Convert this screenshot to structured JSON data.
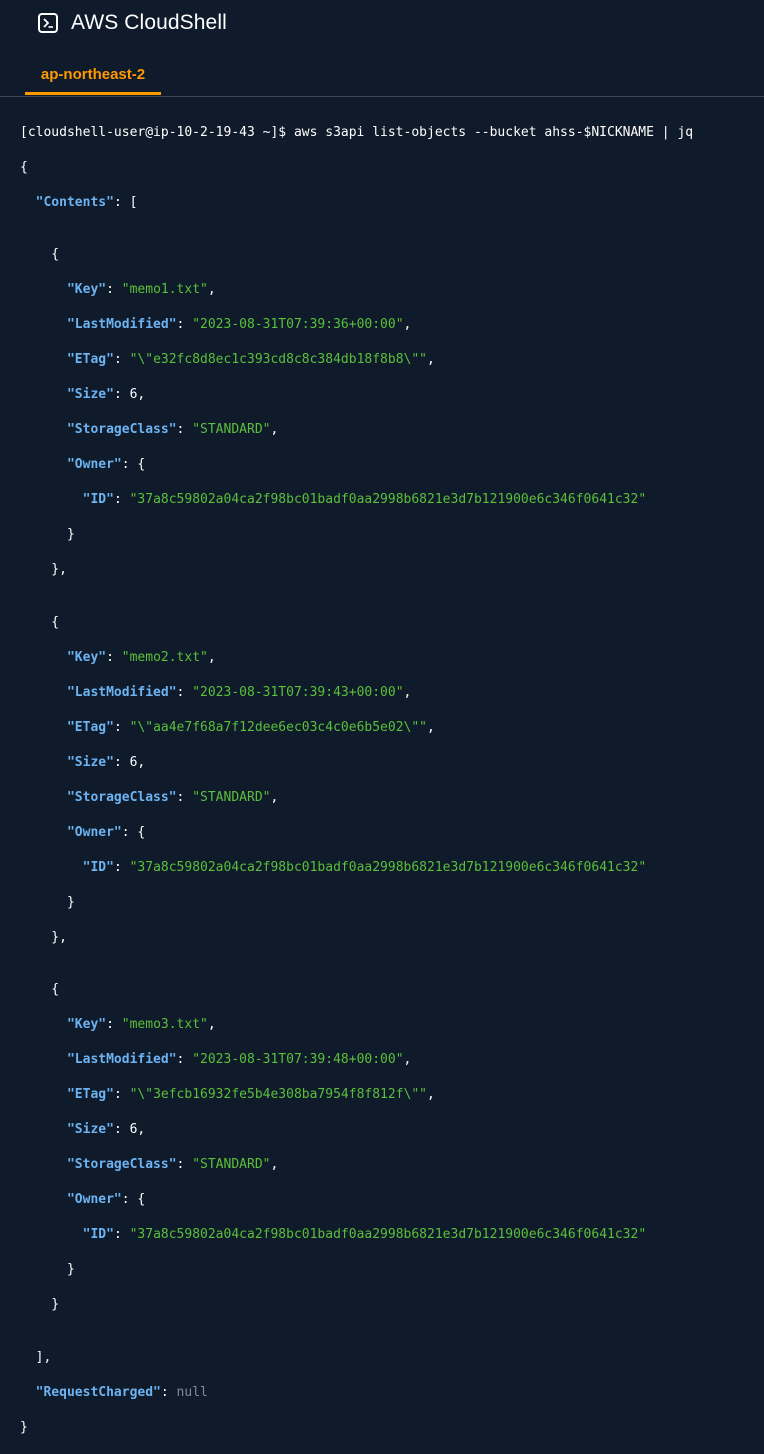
{
  "header": {
    "title": "AWS CloudShell",
    "tab": "ap-northeast-2"
  },
  "icons": {
    "app": "terminal-prompt-icon"
  },
  "colors": {
    "background": "#0f1b2a",
    "accent": "#ff9900",
    "json_key": "#6db3f2",
    "json_string": "#5bbf3a",
    "json_null": "#7d8a99"
  },
  "terminal": {
    "prompt": "[cloudshell-user@ip-10-2-19-43 ~]$ ",
    "command": "aws s3api list-objects --bucket ahss-$NICKNAME | jq",
    "contents_key": "\"Contents\"",
    "objects": [
      {
        "key": "\"memo1.txt\"",
        "last_modified": "\"2023-08-31T07:39:36+00:00\"",
        "etag": "\"\\\"e32fc8d8ec1c393cd8c8c384db18f8b8\\\"\"",
        "size": "6",
        "storage_class": "\"STANDARD\"",
        "owner_id": "\"37a8c59802a04ca2f98bc01badf0aa2998b6821e3d7b121900e6c346f0641c32\""
      },
      {
        "key": "\"memo2.txt\"",
        "last_modified": "\"2023-08-31T07:39:43+00:00\"",
        "etag": "\"\\\"aa4e7f68a7f12dee6ec03c4c0e6b5e02\\\"\"",
        "size": "6",
        "storage_class": "\"STANDARD\"",
        "owner_id": "\"37a8c59802a04ca2f98bc01badf0aa2998b6821e3d7b121900e6c346f0641c32\""
      },
      {
        "key": "\"memo3.txt\"",
        "last_modified": "\"2023-08-31T07:39:48+00:00\"",
        "etag": "\"\\\"3efcb16932fe5b4e308ba7954f8f812f\\\"\"",
        "size": "6",
        "storage_class": "\"STANDARD\"",
        "owner_id": "\"37a8c59802a04ca2f98bc01badf0aa2998b6821e3d7b121900e6c346f0641c32\""
      }
    ],
    "request_charged_key": "\"RequestCharged\"",
    "request_charged_value": "null"
  }
}
